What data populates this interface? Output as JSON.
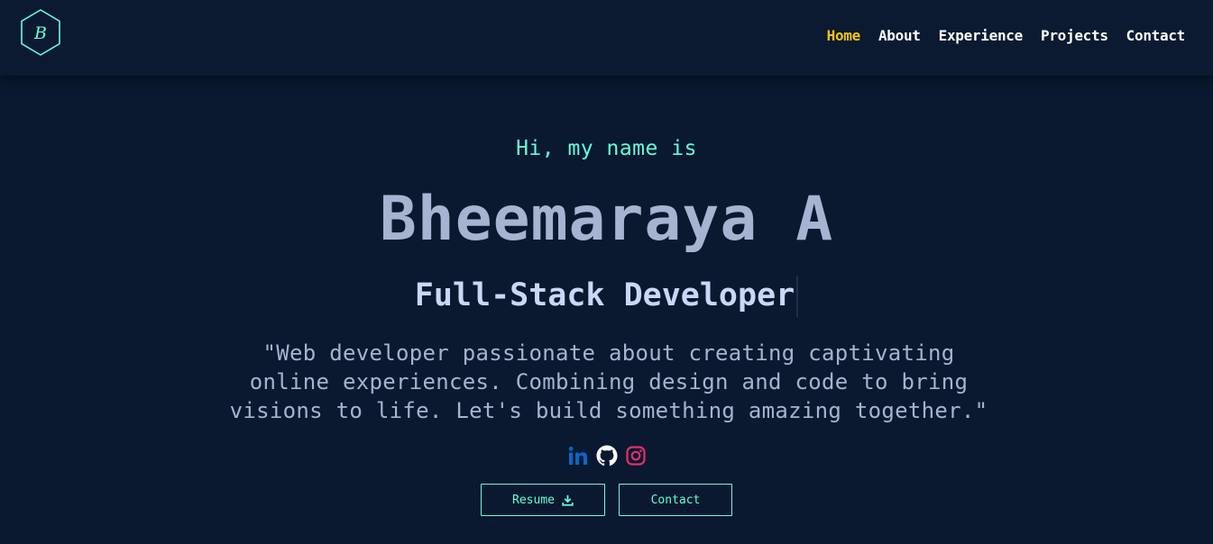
{
  "logo": {
    "letter": "B",
    "icon": "hexagon-logo-icon"
  },
  "nav": {
    "items": [
      {
        "label": "Home",
        "active": true
      },
      {
        "label": "About",
        "active": false
      },
      {
        "label": "Experience",
        "active": false
      },
      {
        "label": "Projects",
        "active": false
      },
      {
        "label": "Contact",
        "active": false
      }
    ]
  },
  "hero": {
    "greeting": "Hi, my name is",
    "name": "Bheemaraya A",
    "role": "Full-Stack Developer",
    "tagline": "\"Web developer passionate about creating captivating online experiences. Combining design and code to bring visions to life. Let's build something amazing together.\""
  },
  "socials": [
    {
      "icon": "linkedin-icon",
      "color": "#0a66c2"
    },
    {
      "icon": "github-icon",
      "color": "#ffffff"
    },
    {
      "icon": "instagram-icon",
      "color": "#e1306c"
    }
  ],
  "buttons": {
    "resume_label": "Resume",
    "resume_icon": "download-icon",
    "contact_label": "Contact"
  },
  "colors": {
    "background": "#0a192f",
    "accent": "#64ffda",
    "active_nav": "#f5c518",
    "name_text": "#a8b2d1",
    "role_text": "#ccd6f6"
  }
}
